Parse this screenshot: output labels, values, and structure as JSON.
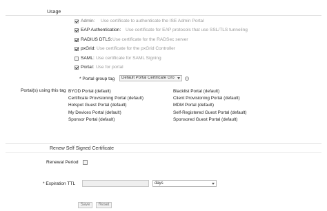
{
  "usage": {
    "title": "Usage",
    "options": [
      {
        "name": "Admin:",
        "desc": "Use certificate to authenticate the ISE Admin Portal",
        "checked": true
      },
      {
        "name": "EAP Authentication:",
        "desc": "Use certificate for EAP protocols that use SSL/TLS tunneling",
        "checked": true
      },
      {
        "name": "RADIUS DTLS:",
        "desc": "Use certificate for the RADSec server",
        "checked": true
      },
      {
        "name": "pxGrid:",
        "desc": "Use certificate for the pxGrid Controller",
        "checked": true
      },
      {
        "name": "SAML:",
        "desc": "Use certificate for SAML Signing",
        "checked": false
      },
      {
        "name": "Portal:",
        "desc": "Use for portal",
        "checked": true
      }
    ],
    "portal_group_tag": {
      "label": "* Portal group tag",
      "value": "Default Portal Certificate Gro"
    },
    "portals_using_tag": {
      "label": "Portal(s) using this tag",
      "left": [
        "BYOD Portal (default)",
        "Certificate Provisioning Portal (default)",
        "Hotspot Guest Portal (default)",
        "My Devices Portal (default)",
        "Sponsor Portal (default)"
      ],
      "right": [
        "Blacklist Portal (default)",
        "Client Provisioning Portal (default)",
        "MDM Portal (default)",
        "Self-Registered Guest Portal (default)",
        "Sponsored Guest Portal (default)"
      ]
    }
  },
  "renew": {
    "title": "Renew Self Signed Certificate",
    "renewal_period_label": "Renewal Period",
    "renewal_checked": false,
    "expiration_label": "* Expiration TTL",
    "expiration_value": "",
    "unit_value": "days"
  },
  "buttons": {
    "save": "Save",
    "reset": "Reset"
  }
}
